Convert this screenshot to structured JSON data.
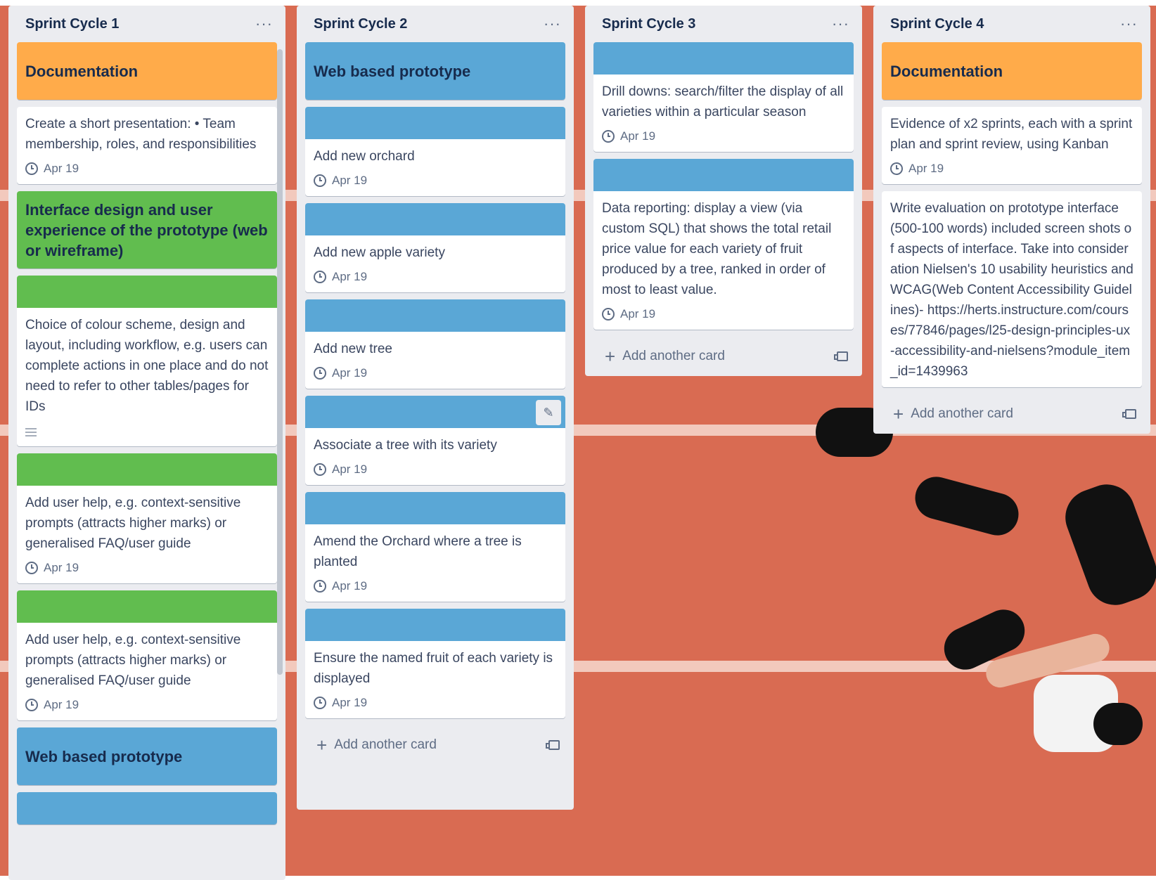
{
  "board": {
    "lists": [
      {
        "title": "Sprint Cycle 1",
        "menu": "···",
        "cards": [
          {
            "cover": "orange",
            "cover_text": "Documentation"
          },
          {
            "title": "Create a short presentation: • Team membership, roles, and responsibilities",
            "due": "Apr 19"
          },
          {
            "cover": "green",
            "cover_text": "Interface design and user experience of the prototype (web or wireframe)"
          },
          {
            "cover": "green",
            "title": "Choice of colour scheme, design and layout, including workflow, e.g. users can complete actions in one place and do not need to refer to other tables/pages for IDs",
            "has_description": true
          },
          {
            "cover": "green",
            "title": "Add user help, e.g. context-sensitive prompts (attracts higher marks) or generalised FAQ/user guide",
            "due": "Apr 19"
          },
          {
            "cover": "green",
            "title": "Add user help, e.g. context-sensitive prompts (attracts higher marks) or generalised FAQ/user guide",
            "due": "Apr 19"
          },
          {
            "cover": "blue",
            "cover_text": "Web based prototype"
          },
          {
            "cover": "blue"
          }
        ]
      },
      {
        "title": "Sprint Cycle 2",
        "menu": "···",
        "cards": [
          {
            "cover": "blue",
            "cover_text": "Web based prototype"
          },
          {
            "cover": "blue",
            "title": "Add new orchard",
            "due": "Apr 19"
          },
          {
            "cover": "blue",
            "title": "Add new apple variety",
            "due": "Apr 19"
          },
          {
            "cover": "blue",
            "title": "Add new tree",
            "due": "Apr 19"
          },
          {
            "cover": "blue",
            "title": "Associate a tree with its variety",
            "due": "Apr 19",
            "edit_icon": "pencil-icon"
          },
          {
            "cover": "blue",
            "title": "Amend the Orchard where a tree is planted",
            "due": "Apr 19"
          },
          {
            "cover": "blue",
            "title": "Ensure the named fruit of each variety is displayed",
            "due": "Apr 19"
          }
        ],
        "add_card": "Add another card"
      },
      {
        "title": "Sprint Cycle 3",
        "menu": "···",
        "cards": [
          {
            "cover": "blue",
            "title": "Drill downs: search/filter the display of all varieties within a particular season",
            "due": "Apr 19"
          },
          {
            "cover": "blue",
            "title": "Data reporting: display a view (via custom SQL) that shows the total retail price value for each variety of fruit produced by a tree, ranked in order of most to least value.",
            "due": "Apr 19"
          }
        ],
        "add_card": "Add another card"
      },
      {
        "title": "Sprint Cycle 4",
        "menu": "···",
        "cards": [
          {
            "cover": "orange",
            "cover_text": "Documentation"
          },
          {
            "title": "Evidence of x2 sprints, each with a sprint plan and sprint review, using Kanban",
            "due": "Apr 19"
          },
          {
            "title": "Write evaluation on prototype interface (500-100 words) included screen shots of aspects of interface. Take into consideration Nielsen's 10 usability heuristics and WCAG(Web Content Accessibility Guidelines)- https://herts.instructure.com/courses/77846/pages/l25-design-principles-ux-accessibility-and-nielsens?module_item_id=1439963"
          }
        ],
        "add_card": "Add another card"
      }
    ]
  },
  "colors": {
    "orange": "#ffab4a",
    "green": "#61bd4f",
    "blue": "#5aa7d6",
    "list_bg": "#ebecf0"
  }
}
